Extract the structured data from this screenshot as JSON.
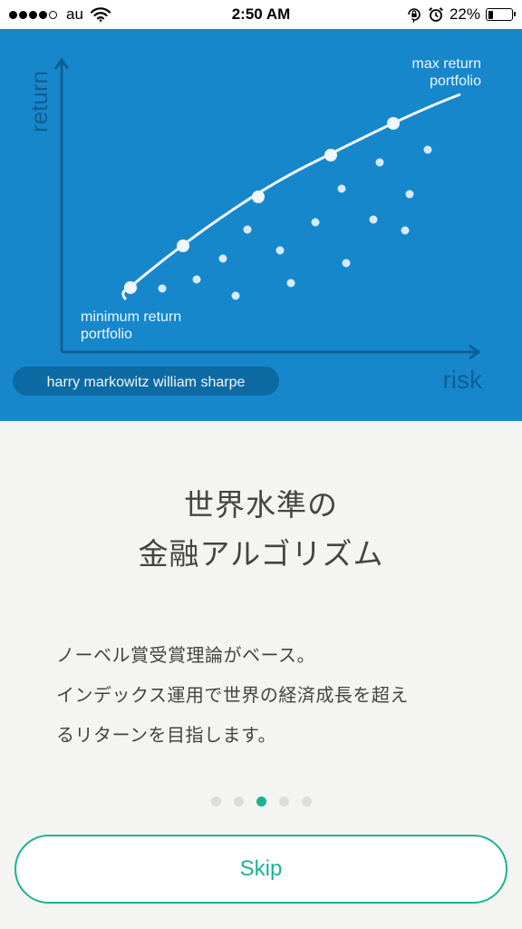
{
  "status_bar": {
    "carrier": "au",
    "time": "2:50 AM",
    "battery_percent_label": "22%",
    "battery_level": 0.22,
    "signal_bars_filled": 4,
    "signal_bars_total": 5
  },
  "hero": {
    "background_color": "#1787cc",
    "y_axis_label": "return",
    "x_axis_label": "risk",
    "max_label_line1": "max return",
    "max_label_line2": "portfolio",
    "min_label_line1": "minimum return",
    "min_label_line2": "portfolio",
    "credit_pill": "harry markowitz william sharpe"
  },
  "content": {
    "headline_line1": "世界水準の",
    "headline_line2": "金融アルゴリズム",
    "body_line1": "ノーベル賞受賞理論がベース。",
    "body_line2": "インデックス運用で世界の経済成長を超え",
    "body_line3": "るリターンを目指します。"
  },
  "pager": {
    "total_pages": 5,
    "active_index": 2,
    "active_color": "#1ab394"
  },
  "actions": {
    "skip_label": "Skip"
  },
  "colors": {
    "accent": "#1ab394",
    "hero_blue": "#1787cc",
    "text": "#444444"
  },
  "icons": {
    "wifi": "wifi-icon",
    "orientation_lock": "orientation-lock-icon",
    "alarm": "alarm-clock-icon",
    "battery": "battery-icon"
  }
}
